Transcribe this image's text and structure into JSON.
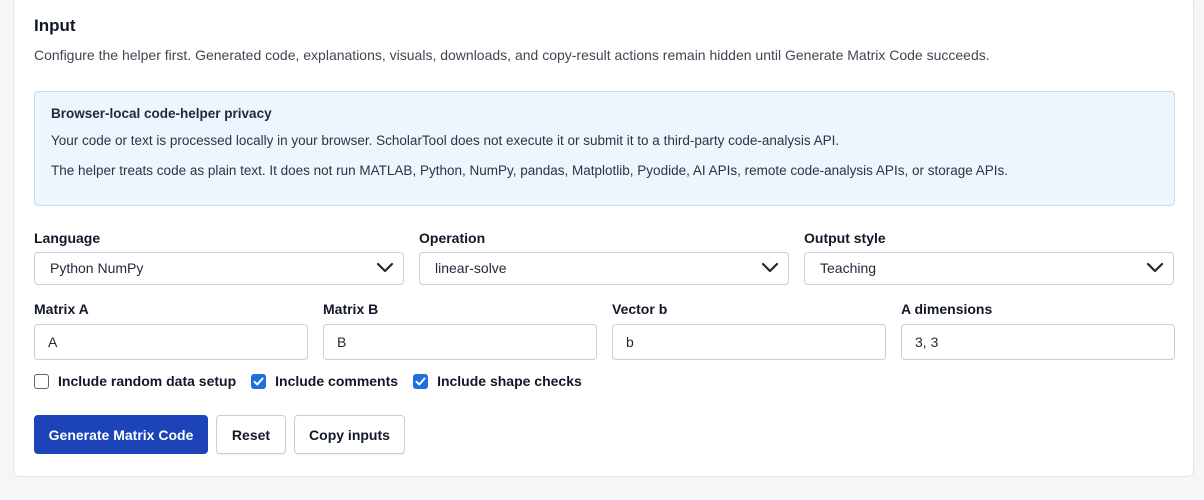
{
  "section": {
    "title": "Input",
    "description": "Configure the helper first. Generated code, explanations, visuals, downloads, and copy-result actions remain hidden until Generate Matrix Code succeeds."
  },
  "privacy": {
    "title": "Browser-local code-helper privacy",
    "p1": "Your code or text is processed locally in your browser. ScholarTool does not execute it or submit it to a third-party code-analysis API.",
    "p2": "The helper treats code as plain text. It does not run MATLAB, Python, NumPy, pandas, Matplotlib, Pyodide, AI APIs, remote code-analysis APIs, or storage APIs."
  },
  "fields": {
    "language": {
      "label": "Language",
      "value": "Python NumPy"
    },
    "operation": {
      "label": "Operation",
      "value": "linear-solve"
    },
    "output_style": {
      "label": "Output style",
      "value": "Teaching"
    },
    "matrix_a": {
      "label": "Matrix A",
      "value": "A"
    },
    "matrix_b": {
      "label": "Matrix B",
      "value": "B"
    },
    "vector_b": {
      "label": "Vector b",
      "value": "b"
    },
    "a_dimensions": {
      "label": "A dimensions",
      "value": "3, 3"
    }
  },
  "options": {
    "random_data": {
      "label": "Include random data setup",
      "checked": false
    },
    "comments": {
      "label": "Include comments",
      "checked": true
    },
    "shape_checks": {
      "label": "Include shape checks",
      "checked": true
    }
  },
  "buttons": {
    "generate": "Generate Matrix Code",
    "reset": "Reset",
    "copy_inputs": "Copy inputs"
  },
  "colors": {
    "primary": "#1c43b8",
    "checkbox": "#1f6fe0",
    "privacy_bg": "#eef5ff"
  }
}
